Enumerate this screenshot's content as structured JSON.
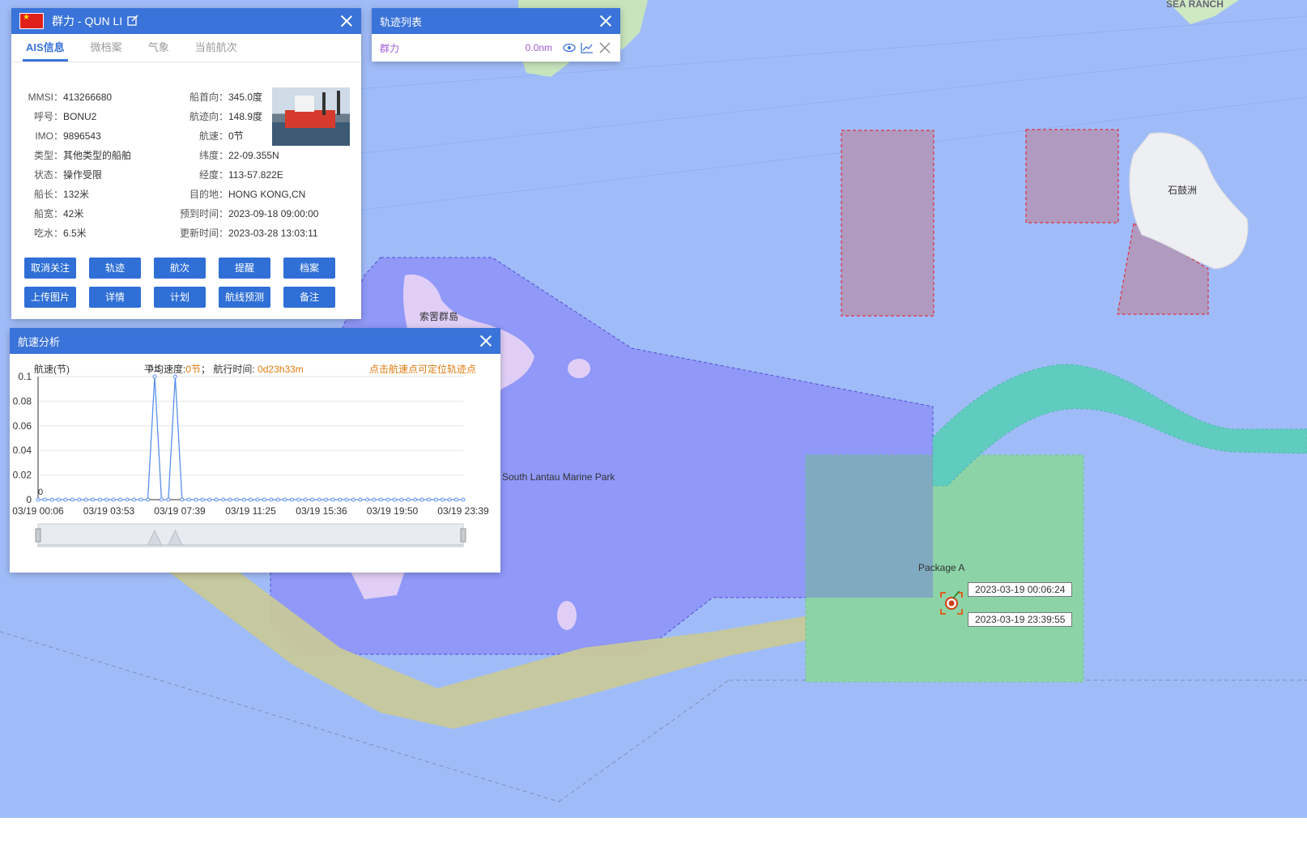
{
  "ship_panel": {
    "name": "群力 - QUN LI",
    "tabs": [
      "AIS信息",
      "微档案",
      "气象",
      "当前航次"
    ],
    "left_fields": [
      {
        "label": "MMSI：",
        "value": "413266680"
      },
      {
        "label": "呼号：",
        "value": "BONU2"
      },
      {
        "label": "IMO：",
        "value": "9896543"
      },
      {
        "label": "类型：",
        "value": "其他类型的船舶"
      },
      {
        "label": "状态：",
        "value": "操作受限"
      },
      {
        "label": "船长：",
        "value": "132米"
      },
      {
        "label": "船宽：",
        "value": "42米"
      },
      {
        "label": "吃水：",
        "value": "6.5米"
      }
    ],
    "right_fields": [
      {
        "label": "船首向：",
        "value": "345.0度"
      },
      {
        "label": "航迹向：",
        "value": "148.9度"
      },
      {
        "label": "航速：",
        "value": "0节"
      },
      {
        "label": "纬度：",
        "value": "22-09.355N"
      },
      {
        "label": "经度：",
        "value": "113-57.822E"
      },
      {
        "label": "目的地：",
        "value": "HONG KONG,CN"
      },
      {
        "label": "预到时间：",
        "value": "2023-09-18 09:00:00"
      },
      {
        "label": "更新时间：",
        "value": "2023-03-28 13:03:11"
      }
    ],
    "buttons_row1": [
      "取消关注",
      "轨迹",
      "航次",
      "提醒",
      "档案"
    ],
    "buttons_row2": [
      "上传图片",
      "详情",
      "计划",
      "航线预测",
      "备注"
    ]
  },
  "track_panel": {
    "title": "轨迹列表",
    "ship": "群力",
    "distance": "0.0nm"
  },
  "speed_panel": {
    "title": "航速分析",
    "ylabel": "航速(节)",
    "avg_label": "平均速度:",
    "avg_value": "0节",
    "sep": "；",
    "time_label": "航行时间:",
    "time_value": "0d23h33m",
    "hint": "点击航速点可定位轨迹点"
  },
  "chart_data": {
    "type": "line",
    "ylabel": "航速(节)",
    "ylim": [
      0,
      0.1
    ],
    "yticks": [
      "0.1",
      "0.08",
      "0.06",
      "0.04",
      "0.02",
      "0"
    ],
    "xticks": [
      "03/19 00:06",
      "03/19 03:53",
      "03/19 07:39",
      "03/19 11:25",
      "03/19 15:36",
      "03/19 19:50",
      "03/19 23:39"
    ],
    "series": [
      {
        "values": [
          0,
          0,
          0,
          0,
          0,
          0,
          0,
          0,
          0,
          0,
          0,
          0,
          0,
          0,
          0,
          0,
          0,
          0.1,
          0,
          0,
          0.1,
          0,
          0,
          0,
          0,
          0,
          0,
          0,
          0,
          0,
          0,
          0,
          0,
          0,
          0,
          0,
          0,
          0,
          0,
          0,
          0,
          0,
          0,
          0,
          0,
          0,
          0,
          0,
          0,
          0,
          0,
          0,
          0,
          0,
          0,
          0,
          0,
          0,
          0,
          0,
          0,
          0,
          0
        ]
      }
    ],
    "point_labels": [
      "0.1",
      "0"
    ],
    "line_color": "#5b8ff0"
  },
  "map": {
    "labels": {
      "island1": "索罟群島",
      "park": "South Lantau Marine Park",
      "island2": "石鼓洲",
      "package": "Package A",
      "top": "SEA RANCH"
    },
    "time_start": "2023-03-19 00:06:24",
    "time_end": "2023-03-19 23:39:55"
  }
}
